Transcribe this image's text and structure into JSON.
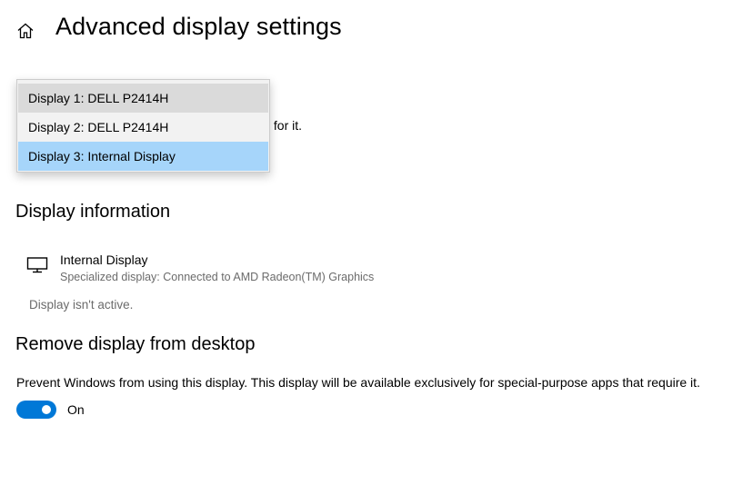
{
  "header": {
    "title": "Advanced display settings",
    "home_icon": "home-icon"
  },
  "select_display": {
    "partial_description": "s for it.",
    "options": [
      {
        "label": "Display 1: DELL P2414H",
        "state": "hover"
      },
      {
        "label": "Display 2: DELL P2414H",
        "state": "normal"
      },
      {
        "label": "Display 3: Internal Display",
        "state": "selected"
      }
    ]
  },
  "display_information": {
    "heading": "Display information",
    "icon": "monitor-icon",
    "name": "Internal Display",
    "details": "Specialized display: Connected to AMD Radeon(TM) Graphics",
    "status": "Display isn't active."
  },
  "remove_display": {
    "heading": "Remove display from desktop",
    "description": "Prevent Windows from using this display. This display will be available exclusively for special-purpose apps that require it.",
    "toggle_state": "On",
    "toggle_on": true
  },
  "colors": {
    "accent": "#0078d7",
    "selected_item": "#a6d5fa",
    "hover_item": "#dadada",
    "dropdown_bg": "#f2f2f2",
    "secondary_text": "#6b6b6b"
  }
}
